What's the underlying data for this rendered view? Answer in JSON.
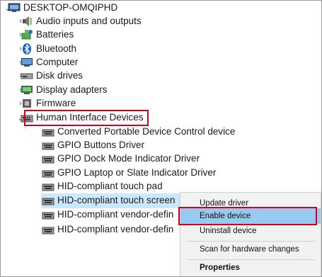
{
  "tree": {
    "root": {
      "label": "DESKTOP-OMQIPHD",
      "icon": "computer-icon"
    },
    "categories": [
      {
        "label": "Audio inputs and outputs",
        "icon": "speaker-icon"
      },
      {
        "label": "Batteries",
        "icon": "battery-icon"
      },
      {
        "label": "Bluetooth",
        "icon": "bluetooth-icon"
      },
      {
        "label": "Computer",
        "icon": "computer-icon"
      },
      {
        "label": "Disk drives",
        "icon": "disk-drive-icon"
      },
      {
        "label": "Display adapters",
        "icon": "display-adapter-icon"
      },
      {
        "label": "Firmware",
        "icon": "firmware-icon"
      },
      {
        "label": "Human Interface Devices",
        "icon": "hid-icon"
      }
    ],
    "hid_children": [
      {
        "label": "Converted Portable Device Control device",
        "icon": "hid-icon"
      },
      {
        "label": "GPIO Buttons Driver",
        "icon": "hid-icon"
      },
      {
        "label": "GPIO Dock Mode Indicator Driver",
        "icon": "hid-icon"
      },
      {
        "label": "GPIO Laptop or Slate Indicator Driver",
        "icon": "hid-icon"
      },
      {
        "label": "HID-compliant touch pad",
        "icon": "hid-icon"
      },
      {
        "label": "HID-compliant touch screen",
        "icon": "hid-icon"
      },
      {
        "label": "HID-compliant vendor-defin",
        "icon": "hid-icon"
      },
      {
        "label": "HID-compliant vendor-defin",
        "icon": "hid-icon"
      }
    ]
  },
  "context_menu": {
    "update_driver": "Update driver",
    "enable_device": "Enable device",
    "uninstall_device": "Uninstall device",
    "scan": "Scan for hardware changes",
    "properties": "Properties"
  },
  "colors": {
    "highlight_red": "#d0021b",
    "menu_selected": "#99c9ef",
    "menu_bg": "#f2f2f2",
    "row_selected": "#cce8ff"
  }
}
